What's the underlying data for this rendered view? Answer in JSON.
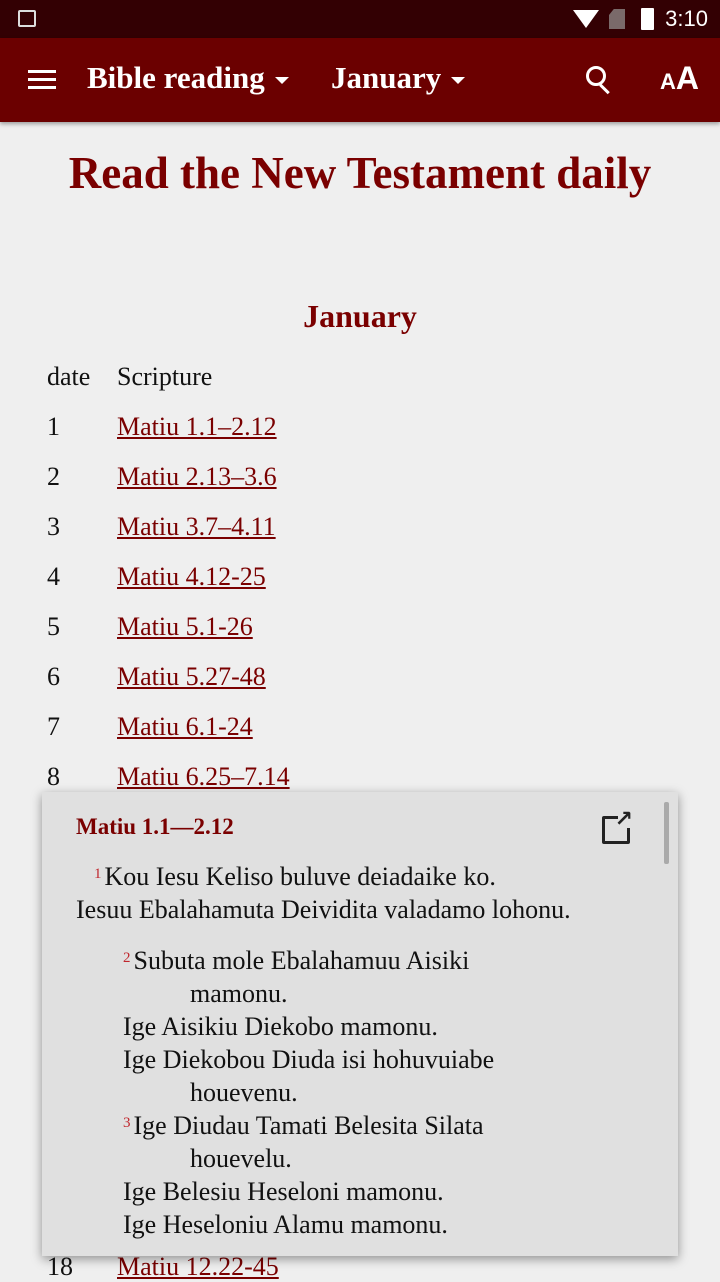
{
  "status_bar": {
    "time": "3:10",
    "icons": [
      "image-icon",
      "wifi-icon",
      "no-sim-icon",
      "battery-icon"
    ]
  },
  "toolbar": {
    "book_select": "Bible reading",
    "month_select": "January",
    "icons": [
      "menu-icon",
      "search-icon",
      "text-size-icon"
    ],
    "text_size_label_small": "A",
    "text_size_label_large": "A"
  },
  "colors": {
    "toolbar": "#6b0000",
    "status_bar": "#330003",
    "accent": "#7a0000",
    "verse_number": "#c0262d"
  },
  "page": {
    "title": "Read the New Testament daily",
    "month_heading": "January",
    "columns": [
      "date",
      "Scripture"
    ],
    "rows": [
      {
        "date": "1",
        "ref": "Matiu 1.1–2.12"
      },
      {
        "date": "2",
        "ref": "Matiu 2.13–3.6"
      },
      {
        "date": "3",
        "ref": "Matiu 3.7–4.11"
      },
      {
        "date": "4",
        "ref": "Matiu 4.12-25"
      },
      {
        "date": "5",
        "ref": "Matiu 5.1-26"
      },
      {
        "date": "6",
        "ref": "Matiu 5.27-48"
      },
      {
        "date": "7",
        "ref": "Matiu 6.1-24"
      },
      {
        "date": "8",
        "ref": "Matiu 6.25–7.14"
      }
    ],
    "visible_row_below": {
      "date": "18",
      "ref": "Matiu 12.22-45"
    }
  },
  "popup": {
    "reference": "Matiu 1.1—2.12",
    "lines": [
      {
        "num": "1",
        "text": "Kou Iesu Keliso buluve deiadaike ko."
      },
      {
        "num": "",
        "text": "Iesuu Ebalahamuta Deividita valadamo lohonu."
      },
      {
        "num": "2",
        "text": "Subuta mole Ebalahamuu Aisiki"
      },
      {
        "num": "",
        "text": "mamonu."
      },
      {
        "num": "",
        "text": "Ige Aisikiu Diekobo mamonu."
      },
      {
        "num": "",
        "text": "Ige Diekobou Diuda isi hohuvuiabe"
      },
      {
        "num": "",
        "text": "houevenu."
      },
      {
        "num": "3",
        "text": "Ige Diudau Tamati Belesita Silata"
      },
      {
        "num": "",
        "text": "houevelu."
      },
      {
        "num": "",
        "text": "Ige Belesiu Heseloni mamonu."
      },
      {
        "num": "",
        "text": "Ige Heseloniu Alamu mamonu."
      }
    ]
  }
}
